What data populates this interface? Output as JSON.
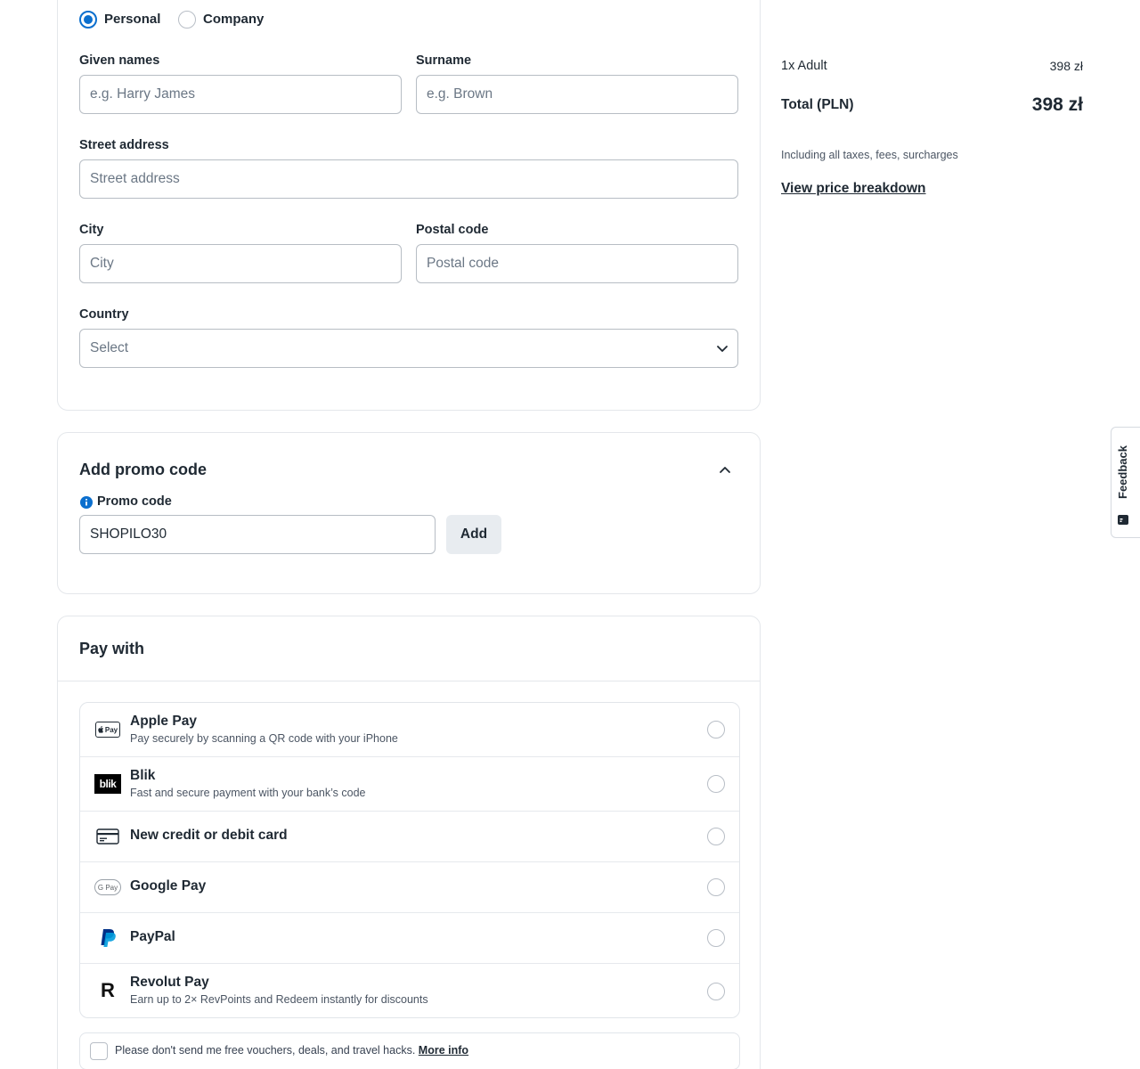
{
  "billing": {
    "customer_types": {
      "personal": "Personal",
      "company": "Company",
      "selected": "Personal"
    },
    "given_names": {
      "label": "Given names",
      "placeholder": "e.g. Harry James",
      "value": ""
    },
    "surname": {
      "label": "Surname",
      "placeholder": "e.g. Brown",
      "value": ""
    },
    "street": {
      "label": "Street address",
      "placeholder": "Street address",
      "value": ""
    },
    "city": {
      "label": "City",
      "placeholder": "City",
      "value": ""
    },
    "postal": {
      "label": "Postal code",
      "placeholder": "Postal code",
      "value": ""
    },
    "country": {
      "label": "Country",
      "selected": "Select",
      "icon": "chevron-down-icon"
    }
  },
  "promo": {
    "title": "Add promo code",
    "collapse_icon": "chevron-up-icon",
    "field_label": "Promo code",
    "info_icon": "info-icon",
    "value": "SHOPILO30",
    "add_label": "Add"
  },
  "payment": {
    "title": "Pay with",
    "methods": [
      {
        "name": "Apple Pay",
        "description": "Pay securely by scanning a QR code with your iPhone",
        "icon": "apple-pay-icon",
        "icon_text": "Pay"
      },
      {
        "name": "Blik",
        "description": "Fast and secure payment with your bank’s code",
        "icon": "blik-icon",
        "icon_text": "blik"
      },
      {
        "name": "New credit or debit card",
        "description": "",
        "icon": "credit-card-icon"
      },
      {
        "name": "Google Pay",
        "description": "",
        "icon": "google-pay-icon",
        "icon_text": "G Pay"
      },
      {
        "name": "PayPal",
        "description": "",
        "icon": "paypal-icon"
      },
      {
        "name": "Revolut Pay",
        "description": "Earn up to 2× RevPoints and Redeem instantly for discounts",
        "icon": "revolut-icon",
        "icon_text": "R"
      }
    ],
    "optout_text": "Please don't send me free vouchers, deals, and travel hacks.",
    "optout_link": "More info"
  },
  "summary": {
    "adult_label": "1x Adult",
    "adult_price": "398 zł",
    "total_label": "Total (PLN)",
    "total_price": "398 zł",
    "taxes_note": "Including all taxes, fees, surcharges",
    "breakdown_link": "View price breakdown"
  },
  "feedback": {
    "label": "Feedback",
    "icon": "feedback-icon"
  },
  "colors": {
    "accent": "#0b6fce",
    "text": "#1f2933",
    "muted": "#6b7785",
    "border": "#b7bdc4",
    "paypal_dark": "#003087",
    "paypal_light": "#009cde"
  }
}
